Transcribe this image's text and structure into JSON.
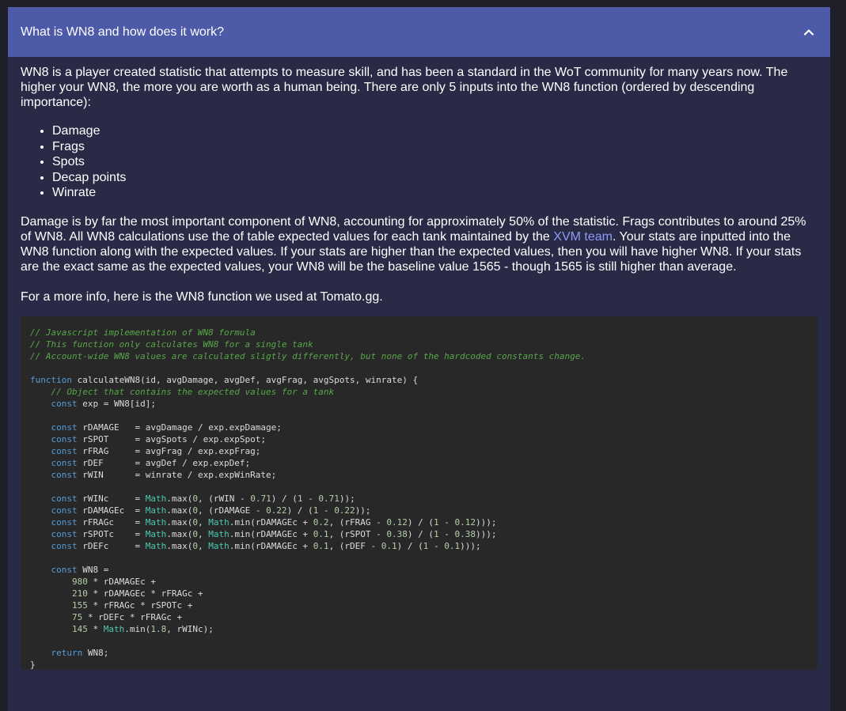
{
  "panel": {
    "title": "What is WN8 and how does it work?",
    "expanded": true,
    "header_color": "#4c5aa8",
    "body_color": "#292a45"
  },
  "content": {
    "intro": "WN8 is a player created statistic that attempts to measure skill, and has been a standard in the WoT community for many years now. The higher your WN8, the more you are worth as a human being. There are only 5 inputs into the WN8 function (ordered by descending importance):",
    "inputs": [
      "Damage",
      "Frags",
      "Spots",
      "Decap points",
      "Winrate"
    ],
    "para2_before_link": "Damage is by far the most important component of WN8, accounting for approximately 50% of the statistic. Frags contributes to around 25% of WN8. All WN8 calculations use the of table expected values for each tank maintained by the ",
    "para2_link": "XVM team",
    "para2_after_link": ". Your stats are inputted into the WN8 function along with the expected values. If your stats are higher than the expected values, then you will have higher WN8. If your stats are the exact same as the expected values, your WN8 will be the baseline value 1565 - though 1565 is still higher than average.",
    "para3": "For a more info, here is the WN8 function we used at Tomato.gg."
  },
  "code": {
    "lines": [
      [
        [
          "c",
          "// Javascript implementation of WN8 formula"
        ]
      ],
      [
        [
          "c",
          "// This function only calculates WN8 for a single tank"
        ]
      ],
      [
        [
          "c",
          "// Account-wide WN8 values are calculated sligtly differently, but none of the hardcoded constants change."
        ]
      ],
      [],
      [
        [
          "k",
          "function"
        ],
        [
          "t",
          " calculateWN8(id, avgDamage, avgDef, avgFrag, avgSpots, winrate) {"
        ]
      ],
      [
        [
          "t",
          "    "
        ],
        [
          "c",
          "// Object that contains the expected values for a tank"
        ]
      ],
      [
        [
          "t",
          "    "
        ],
        [
          "k",
          "const"
        ],
        [
          "t",
          " exp = WN8[id];"
        ]
      ],
      [],
      [
        [
          "t",
          "    "
        ],
        [
          "k",
          "const"
        ],
        [
          "t",
          " rDAMAGE   = avgDamage / exp.expDamage;"
        ]
      ],
      [
        [
          "t",
          "    "
        ],
        [
          "k",
          "const"
        ],
        [
          "t",
          " rSPOT     = avgSpots / exp.expSpot;"
        ]
      ],
      [
        [
          "t",
          "    "
        ],
        [
          "k",
          "const"
        ],
        [
          "t",
          " rFRAG     = avgFrag / exp.expFrag;"
        ]
      ],
      [
        [
          "t",
          "    "
        ],
        [
          "k",
          "const"
        ],
        [
          "t",
          " rDEF      = avgDef / exp.expDef;"
        ]
      ],
      [
        [
          "t",
          "    "
        ],
        [
          "k",
          "const"
        ],
        [
          "t",
          " rWIN      = winrate / exp.expWinRate;"
        ]
      ],
      [],
      [
        [
          "t",
          "    "
        ],
        [
          "k",
          "const"
        ],
        [
          "t",
          " rWINc     = "
        ],
        [
          "m",
          "Math"
        ],
        [
          "t",
          ".max("
        ],
        [
          "n",
          "0"
        ],
        [
          "t",
          ", (rWIN - "
        ],
        [
          "n",
          "0.71"
        ],
        [
          "t",
          ") / ("
        ],
        [
          "n",
          "1"
        ],
        [
          "t",
          " - "
        ],
        [
          "n",
          "0.71"
        ],
        [
          "t",
          "));"
        ]
      ],
      [
        [
          "t",
          "    "
        ],
        [
          "k",
          "const"
        ],
        [
          "t",
          " rDAMAGEc  = "
        ],
        [
          "m",
          "Math"
        ],
        [
          "t",
          ".max("
        ],
        [
          "n",
          "0"
        ],
        [
          "t",
          ", (rDAMAGE - "
        ],
        [
          "n",
          "0.22"
        ],
        [
          "t",
          ") / ("
        ],
        [
          "n",
          "1"
        ],
        [
          "t",
          " - "
        ],
        [
          "n",
          "0.22"
        ],
        [
          "t",
          "));"
        ]
      ],
      [
        [
          "t",
          "    "
        ],
        [
          "k",
          "const"
        ],
        [
          "t",
          " rFRAGc    = "
        ],
        [
          "m",
          "Math"
        ],
        [
          "t",
          ".max("
        ],
        [
          "n",
          "0"
        ],
        [
          "t",
          ", "
        ],
        [
          "m",
          "Math"
        ],
        [
          "t",
          ".min(rDAMAGEc + "
        ],
        [
          "n",
          "0.2"
        ],
        [
          "t",
          ", (rFRAG - "
        ],
        [
          "n",
          "0.12"
        ],
        [
          "t",
          ") / ("
        ],
        [
          "n",
          "1"
        ],
        [
          "t",
          " - "
        ],
        [
          "n",
          "0.12"
        ],
        [
          "t",
          ")));"
        ]
      ],
      [
        [
          "t",
          "    "
        ],
        [
          "k",
          "const"
        ],
        [
          "t",
          " rSPOTc    = "
        ],
        [
          "m",
          "Math"
        ],
        [
          "t",
          ".max("
        ],
        [
          "n",
          "0"
        ],
        [
          "t",
          ", "
        ],
        [
          "m",
          "Math"
        ],
        [
          "t",
          ".min(rDAMAGEc + "
        ],
        [
          "n",
          "0.1"
        ],
        [
          "t",
          ", (rSPOT - "
        ],
        [
          "n",
          "0.38"
        ],
        [
          "t",
          ") / ("
        ],
        [
          "n",
          "1"
        ],
        [
          "t",
          " - "
        ],
        [
          "n",
          "0.38"
        ],
        [
          "t",
          ")));"
        ]
      ],
      [
        [
          "t",
          "    "
        ],
        [
          "k",
          "const"
        ],
        [
          "t",
          " rDEFc     = "
        ],
        [
          "m",
          "Math"
        ],
        [
          "t",
          ".max("
        ],
        [
          "n",
          "0"
        ],
        [
          "t",
          ", "
        ],
        [
          "m",
          "Math"
        ],
        [
          "t",
          ".min(rDAMAGEc + "
        ],
        [
          "n",
          "0.1"
        ],
        [
          "t",
          ", (rDEF - "
        ],
        [
          "n",
          "0.1"
        ],
        [
          "t",
          ") / ("
        ],
        [
          "n",
          "1"
        ],
        [
          "t",
          " - "
        ],
        [
          "n",
          "0.1"
        ],
        [
          "t",
          ")));"
        ]
      ],
      [],
      [
        [
          "t",
          "    "
        ],
        [
          "k",
          "const"
        ],
        [
          "t",
          " WN8 ="
        ]
      ],
      [
        [
          "t",
          "        "
        ],
        [
          "n",
          "980"
        ],
        [
          "t",
          " * rDAMAGEc +"
        ]
      ],
      [
        [
          "t",
          "        "
        ],
        [
          "n",
          "210"
        ],
        [
          "t",
          " * rDAMAGEc * rFRAGc +"
        ]
      ],
      [
        [
          "t",
          "        "
        ],
        [
          "n",
          "155"
        ],
        [
          "t",
          " * rFRAGc * rSPOTc +"
        ]
      ],
      [
        [
          "t",
          "        "
        ],
        [
          "n",
          "75"
        ],
        [
          "t",
          " * rDEFc * rFRAGc +"
        ]
      ],
      [
        [
          "t",
          "        "
        ],
        [
          "n",
          "145"
        ],
        [
          "t",
          " * "
        ],
        [
          "m",
          "Math"
        ],
        [
          "t",
          ".min("
        ],
        [
          "n",
          "1.8"
        ],
        [
          "t",
          ", rWINc);"
        ]
      ],
      [],
      [
        [
          "t",
          "    "
        ],
        [
          "k",
          "return"
        ],
        [
          "t",
          " WN8;"
        ]
      ],
      [
        [
          "t",
          "}"
        ]
      ]
    ]
  }
}
